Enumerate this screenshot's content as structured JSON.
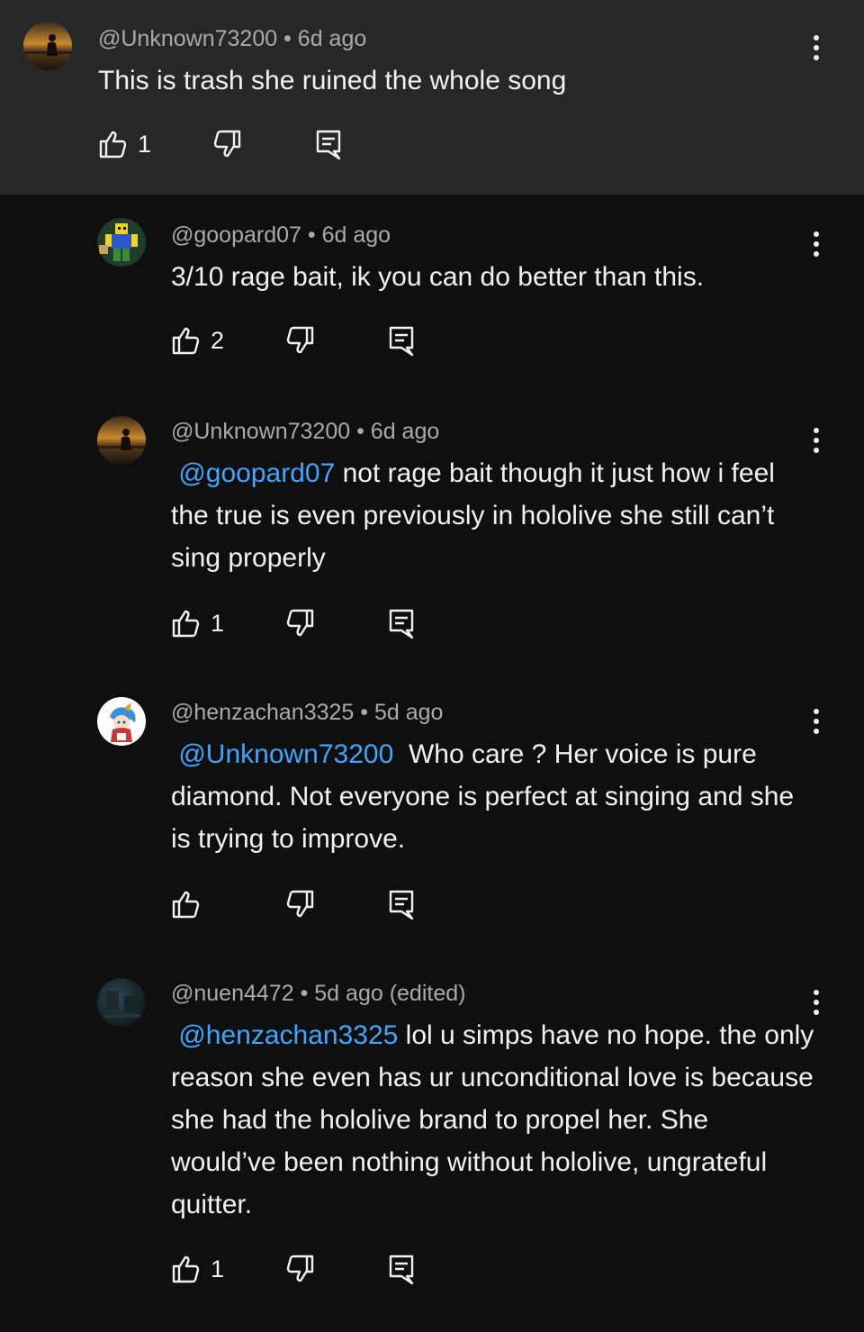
{
  "comments": [
    {
      "user": "@Unknown73200",
      "time": "6d ago",
      "mention": "",
      "text": "This is trash she ruined the whole song",
      "likes": "1",
      "avatar_icon": "sunset-silhouette-avatar"
    },
    {
      "user": "@goopard07",
      "time": "6d ago",
      "mention": "",
      "text": "3/10 rage bait, ik you can do better than this.",
      "likes": "2",
      "avatar_icon": "pixel-character-avatar"
    },
    {
      "user": "@Unknown73200",
      "time": "6d ago",
      "mention": "@goopard07",
      "text": "not rage bait though it just how i feel the true is even previously in hololive she still can’t sing properly",
      "likes": "1",
      "avatar_icon": "sunset-silhouette-avatar"
    },
    {
      "user": "@henzachan3325",
      "time": "5d ago",
      "mention": "@Unknown73200",
      "text": "Who care ? Her voice is pure diamond. Not everyone is perfect at singing and she is trying to improve.",
      "likes": "",
      "avatar_icon": "anime-character-avatar"
    },
    {
      "user": "@nuen4472",
      "time": "5d ago (edited)",
      "mention": "@henzachan3325",
      "text": "lol u simps have no hope. the only reason she even has ur unconditional love is because she had the hololive brand to propel her. She would’ve been nothing without hololive, ungrateful quitter.",
      "likes": "1",
      "avatar_icon": "dark-room-avatar"
    }
  ],
  "separator": "•",
  "colors": {
    "background": "#0f0f0f",
    "highlighted_background": "#272727",
    "text": "#f1f1f1",
    "meta_text": "#aaaaaa",
    "mention": "#3ea6ff"
  }
}
